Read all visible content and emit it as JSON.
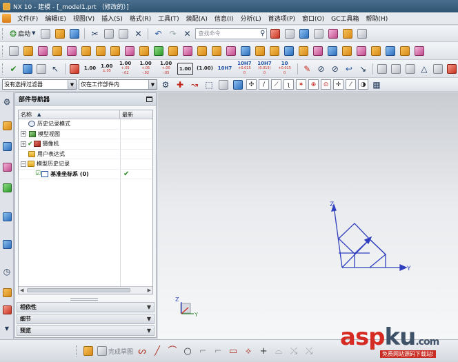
{
  "window": {
    "title": "NX 10 - 建模 - [_model1.prt （修改的）]"
  },
  "menu": [
    "文件(F)",
    "编辑(E)",
    "视图(V)",
    "插入(S)",
    "格式(R)",
    "工具(T)",
    "装配(A)",
    "信息(I)",
    "分析(L)",
    "首选项(P)",
    "窗口(O)",
    "GC工具箱",
    "帮助(H)"
  ],
  "toolbar": {
    "start_label": "启动",
    "search_placeholder": "查找命令",
    "dims": [
      {
        "main": "1.00",
        "sub": ""
      },
      {
        "main": "1.00",
        "sub": "±.05"
      },
      {
        "main": "1.00",
        "sub": "+.05 -.02"
      },
      {
        "main": "1.00",
        "sub": "+.05 -.02"
      },
      {
        "main": "1.00",
        "sub": "+.00 -.05"
      },
      {
        "main": "1.00",
        "sub": ""
      },
      {
        "main": "(1.00)",
        "sub": ""
      },
      {
        "main": "10H7",
        "sub": ""
      },
      {
        "main": "10H7",
        "sub": "+0.015 0"
      },
      {
        "main": "10H7",
        "sub": "(0.015) 0"
      },
      {
        "main": "10",
        "sub": "+0.015 0"
      }
    ]
  },
  "selection_bar": {
    "filter_value": "没有选择过滤器",
    "scope_value": "仅在工作部件内"
  },
  "navigator": {
    "title": "部件导航器",
    "col_name": "名称",
    "col_latest": "最新",
    "rows": [
      {
        "label": "历史记录模式",
        "icon": "clock-icon",
        "expander": "",
        "check": false,
        "latest": ""
      },
      {
        "label": "模型视图",
        "icon": "model-view-icon",
        "expander": "+",
        "check": false,
        "latest": ""
      },
      {
        "label": "摄像机",
        "icon": "camera-icon",
        "expander": "+",
        "check": true,
        "latest": ""
      },
      {
        "label": "用户表达式",
        "icon": "folder-icon",
        "expander": "",
        "check": false,
        "latest": ""
      },
      {
        "label": "模型历史记录",
        "icon": "folder-icon",
        "expander": "−",
        "check": false,
        "latest": ""
      },
      {
        "label": "基准坐标系 (0)",
        "icon": "datum-csys-icon",
        "expander": "",
        "check": true,
        "latest": "✔",
        "bold": true
      }
    ],
    "sections": [
      "相依性",
      "细节",
      "预览"
    ]
  },
  "graphics": {
    "datum_axes": {
      "z": "Z",
      "y": "Y",
      "x": "X"
    },
    "triad": {
      "z": "Z",
      "y": "Y",
      "x": "X"
    }
  },
  "bottombar": {
    "finish_sketch": "完成草图"
  },
  "watermark": {
    "main_a": "asp",
    "main_b": "ku",
    "suffix": ".com",
    "sub": "免费网站源码下载站!"
  },
  "colors": {
    "title_bar": "#3c6282",
    "datum_blue": "#2f3fbf",
    "accent_green": "#2b8a25",
    "watermark_red": "#d62b22"
  }
}
